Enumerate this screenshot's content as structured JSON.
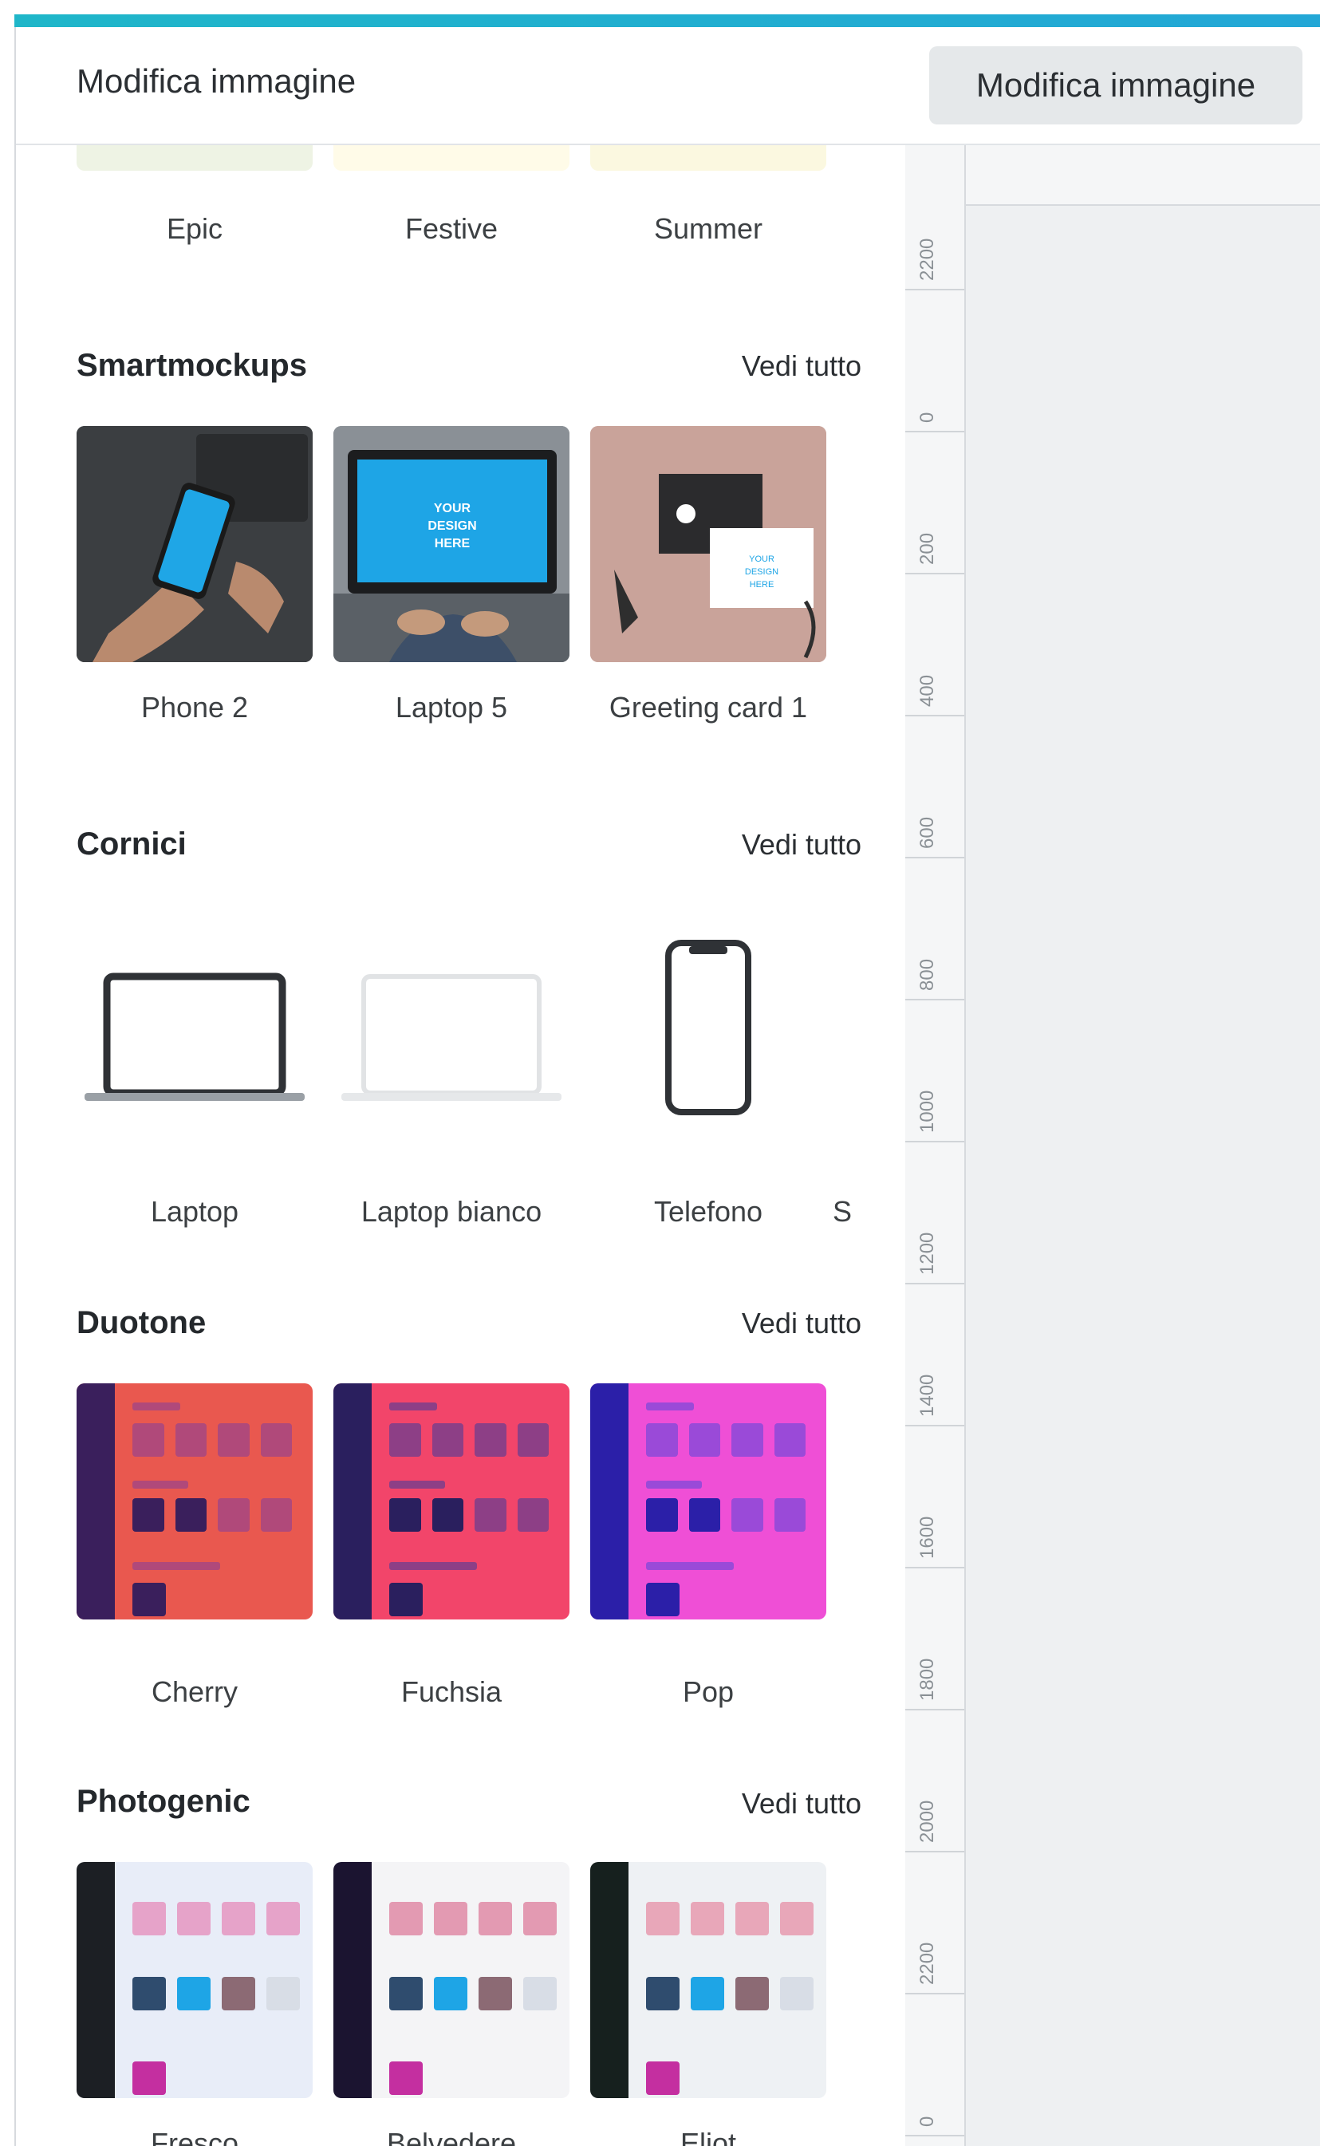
{
  "panel": {
    "title": "Modifica immagine"
  },
  "right": {
    "edit_button": "Modifica immagine",
    "ruler_labels": [
      "2200",
      "0",
      "200",
      "400",
      "600",
      "800",
      "1000",
      "1200",
      "1400",
      "1600",
      "1800",
      "2000",
      "2200",
      "0"
    ]
  },
  "filters": {
    "items": [
      {
        "label": "Epic",
        "color": "#eef3e4"
      },
      {
        "label": "Festive",
        "color": "#fffbe8"
      },
      {
        "label": "Summer",
        "color": "#fbf8e0"
      }
    ]
  },
  "smartmockups": {
    "title": "Smartmockups",
    "see_all": "Vedi tutto",
    "items": [
      {
        "label": "Phone 2"
      },
      {
        "label": "Laptop 5",
        "screen_text": "YOUR DESIGN HERE"
      },
      {
        "label": "Greeting card 1",
        "card_text": "YOUR DESIGN HERE"
      }
    ]
  },
  "cornici": {
    "title": "Cornici",
    "see_all": "Vedi tutto",
    "items": [
      {
        "label": "Laptop"
      },
      {
        "label": "Laptop bianco"
      },
      {
        "label": "Telefono"
      }
    ],
    "overflow_label": "S"
  },
  "duotone": {
    "title": "Duotone",
    "see_all": "Vedi tutto",
    "items": [
      {
        "label": "Cherry",
        "bg": "#e9584f",
        "side": "#3a1f5c",
        "tile": "#b0497a"
      },
      {
        "label": "Fuchsia",
        "bg": "#f2456a",
        "side": "#2a1f5e",
        "tile": "#8d3f86"
      },
      {
        "label": "Pop",
        "bg": "#ef4fd6",
        "side": "#2b1fa8",
        "tile": "#9a4ad8"
      }
    ]
  },
  "photogenic": {
    "title": "Photogenic",
    "see_all": "Vedi tutto",
    "items": [
      {
        "label": "Fresco",
        "tile": "#e6a3c9"
      },
      {
        "label": "Belvedere",
        "tile": "#e39ab2"
      },
      {
        "label": "Eliot",
        "tile": "#e8a7b9"
      }
    ]
  }
}
